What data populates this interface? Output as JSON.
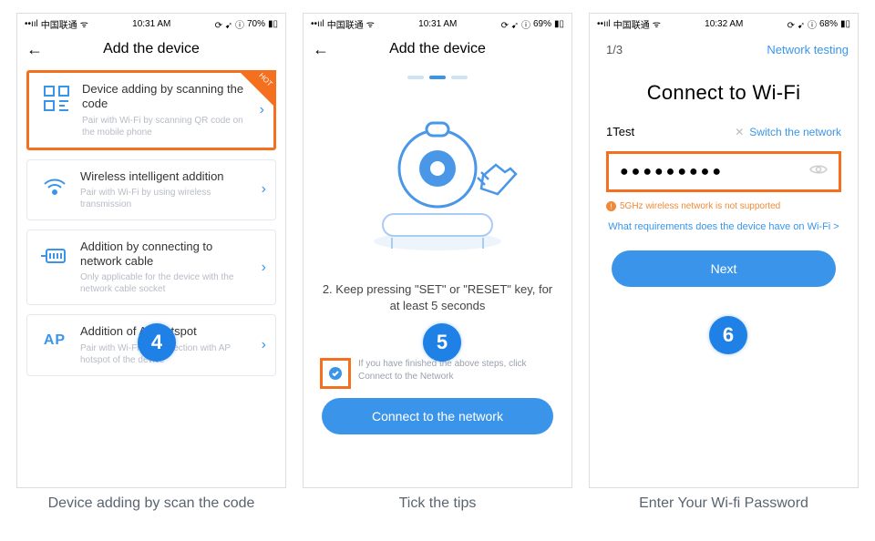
{
  "statusbar": {
    "carrier": "中国联通",
    "time_a": "10:31 AM",
    "time_b": "10:31 AM",
    "time_c": "10:32 AM",
    "battery_a": "70%",
    "battery_b": "69%",
    "battery_c": "68%"
  },
  "phone1": {
    "title": "Add the device",
    "options": [
      {
        "title": "Device adding by scanning the code",
        "sub": "Pair with Wi-Fi by scanning QR code on the mobile phone",
        "icon": "qr-icon",
        "hot": "HOT"
      },
      {
        "title": "Wireless intelligent addition",
        "sub": "Pair with Wi-Fi by using wireless transmission",
        "icon": "wifi-icon"
      },
      {
        "title": "Addition by connecting to network cable",
        "sub": "Only applicable for the device with the network cable socket",
        "icon": "ethernet-icon"
      },
      {
        "title": "Addition of AP hotspot",
        "sub": "Pair with Wi-Fi by connection with AP hotspot of the device",
        "icon_text": "AP"
      }
    ],
    "badge": "4",
    "caption": "Device adding by scan the code"
  },
  "phone2": {
    "title": "Add the device",
    "instruction": "2. Keep pressing \"SET\" or \"RESET\" key, for at least 5 seconds",
    "tick_text": "If you have finished the above steps, click Connect to the Network",
    "button": "Connect to the network",
    "badge": "5",
    "caption": "Tick the tips"
  },
  "phone3": {
    "step": "1/3",
    "right_link": "Network testing",
    "title": "Connect to Wi-Fi",
    "ssid": "1Test",
    "switch_label": "Switch the network",
    "password_mask": "●●●●●●●●●",
    "warning": "5GHz wireless network is not supported",
    "requirements": "What requirements does the device have on Wi-Fi >",
    "button": "Next",
    "badge": "6",
    "caption": "Enter Your Wi-fi Password"
  }
}
